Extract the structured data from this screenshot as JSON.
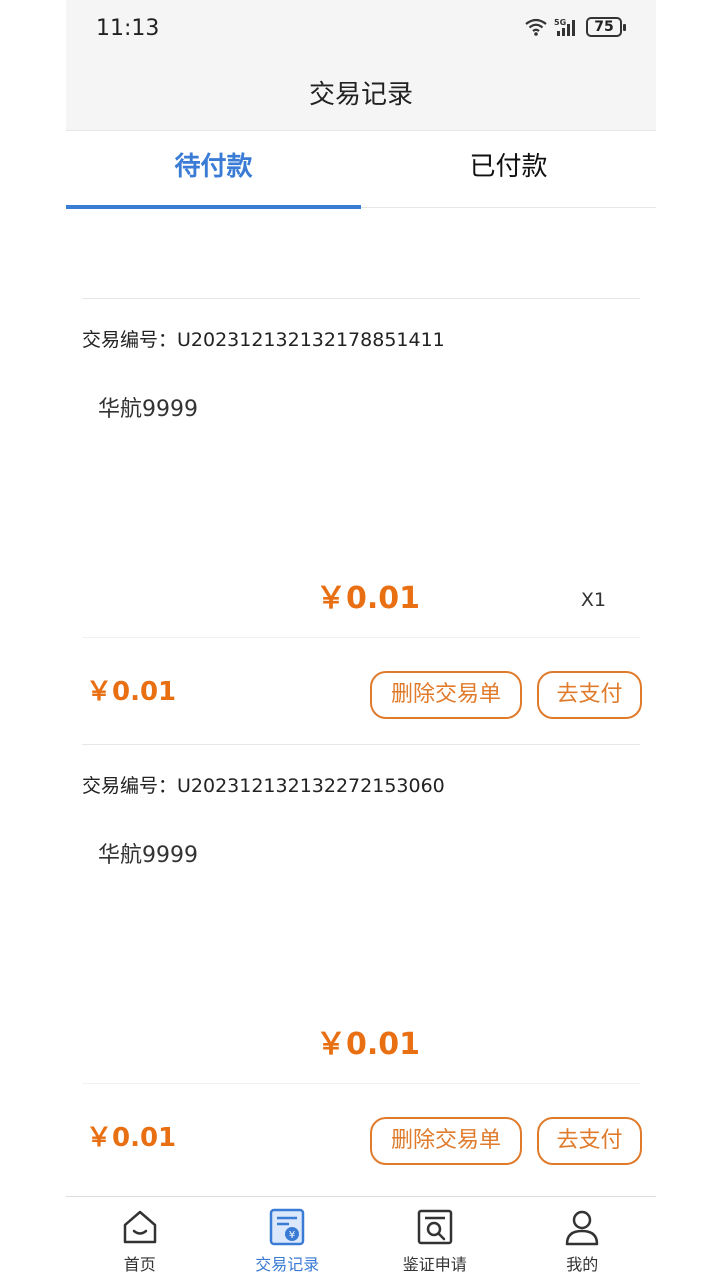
{
  "status_bar": {
    "time": "11:13",
    "network": "5G",
    "battery": "75"
  },
  "header": {
    "title": "交易记录"
  },
  "tabs": [
    {
      "label": "待付款",
      "active": true
    },
    {
      "label": "已付款",
      "active": false
    }
  ],
  "orders": [
    {
      "order_no": "交易编号：U20231213213217885141​1",
      "product_name": "华航9999",
      "item_price": "￥0.01",
      "quantity": "X1",
      "total": "￥0.01",
      "delete_label": "删除交易单",
      "pay_label": "去支付"
    },
    {
      "order_no": "交易编号：U20231213213227215306​0",
      "product_name": "华航9999",
      "item_price": "￥0.01",
      "quantity": "",
      "total": "￥0.01",
      "delete_label": "删除交易单",
      "pay_label": "去支付"
    }
  ],
  "tabbar": [
    {
      "label": "首页",
      "icon": "home-icon",
      "active": false
    },
    {
      "label": "交易记录",
      "icon": "transaction-record-icon",
      "active": true
    },
    {
      "label": "鉴证申请",
      "icon": "verification-search-icon",
      "active": false
    },
    {
      "label": "我的",
      "icon": "user-icon",
      "active": false
    }
  ],
  "colors": {
    "accent": "#3a7bd5",
    "price": "#e86f12",
    "button_border": "#e07b2c"
  }
}
